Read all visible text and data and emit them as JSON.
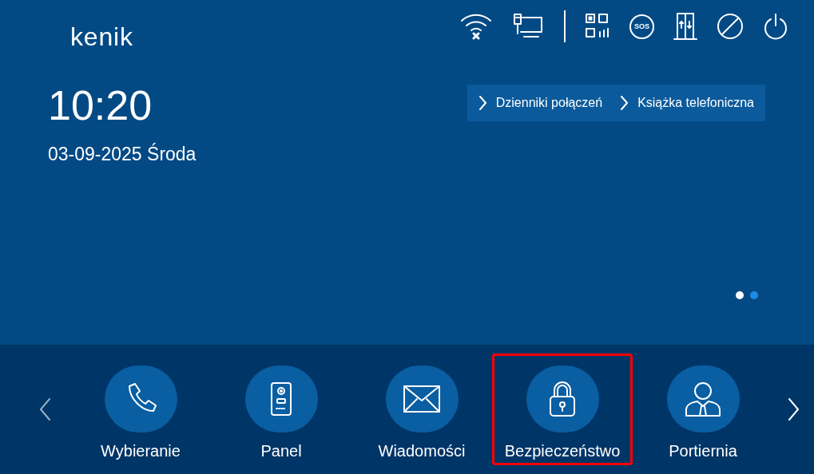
{
  "logo": "kenik",
  "status_icons": [
    {
      "kind": "wifi-off"
    },
    {
      "kind": "monitor"
    },
    {
      "kind": "divider"
    },
    {
      "kind": "qr"
    },
    {
      "kind": "sos",
      "label": "SOS"
    },
    {
      "kind": "elevator"
    },
    {
      "kind": "dnd"
    },
    {
      "kind": "power"
    }
  ],
  "clock": {
    "time": "10:20",
    "date": "03-09-2025 Środa"
  },
  "quick_links": [
    {
      "label": "Dzienniki połączeń"
    },
    {
      "label": "Książka telefoniczna"
    }
  ],
  "page_dots": [
    {
      "selected": true
    },
    {
      "selected": false
    }
  ],
  "nav": {
    "prev_disabled": true,
    "next_disabled": false
  },
  "apps": [
    {
      "kind": "phone",
      "label": "Wybieranie",
      "highlighted": false
    },
    {
      "kind": "panel",
      "label": "Panel",
      "highlighted": false
    },
    {
      "kind": "mail",
      "label": "Wiadomości",
      "highlighted": false
    },
    {
      "kind": "lock",
      "label": "Bezpieczeństwo",
      "highlighted": true
    },
    {
      "kind": "person",
      "label": "Portiernia",
      "highlighted": false
    }
  ]
}
